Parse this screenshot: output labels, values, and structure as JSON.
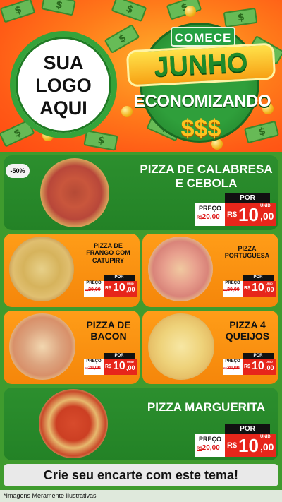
{
  "header": {
    "logo_line1": "SUA",
    "logo_line2": "LOGO",
    "logo_line3": "AQUI",
    "comece": "COMECE",
    "junho": "JUNHO",
    "economizando": "ECONOMIZANDO",
    "dollars": "$$$"
  },
  "discount_badge": "-50%",
  "products": {
    "calabresa": {
      "title_line1": "PIZZA DE CALABRESA",
      "title_line2": "E CEBOLA",
      "por": "POR",
      "preco": "PREÇO",
      "de": "20,00",
      "de_prefix": "R$",
      "currency": "R$",
      "int": "10",
      "dec": ",00",
      "unid": "UNID"
    },
    "frango": {
      "title_line1": "PIZZA DE",
      "title_line2": "FRANGO COM",
      "title_line3": "CATUPIRY",
      "por": "POR",
      "preco": "PREÇO",
      "de": "20,00",
      "de_prefix": "R$",
      "currency": "R$",
      "int": "10",
      "dec": ",00",
      "unid": "UNID"
    },
    "portuguesa": {
      "title_line1": "PIZZA",
      "title_line2": "PORTUGUESA",
      "por": "POR",
      "preco": "PREÇO",
      "de": "20,00",
      "de_prefix": "R$",
      "currency": "R$",
      "int": "10",
      "dec": ",00",
      "unid": "UNID"
    },
    "bacon": {
      "title_line1": "PIZZA DE",
      "title_line2": "BACON",
      "por": "POR",
      "preco": "PREÇO",
      "de": "20,00",
      "de_prefix": "R$",
      "currency": "R$",
      "int": "10",
      "dec": ",00",
      "unid": "UNID"
    },
    "queijos": {
      "title_line1": "PIZZA 4",
      "title_line2": "QUEIJOS",
      "por": "POR",
      "preco": "PREÇO",
      "de": "20,00",
      "de_prefix": "R$",
      "currency": "R$",
      "int": "10",
      "dec": ",00",
      "unid": "UNID"
    },
    "marguerita": {
      "title_line1": "PIZZA MARGUERITA",
      "por": "POR",
      "preco": "PREÇO",
      "de": "20,00",
      "de_prefix": "R$",
      "currency": "R$",
      "int": "10",
      "dec": ",00",
      "unid": "UNID"
    }
  },
  "cta": "Crie seu encarte com este tema!",
  "footnote": "*Imagens Meramente Ilustrativas",
  "colors": {
    "green": "#2c8f2e",
    "orange": "#f5860a",
    "price_red": "#e7261b",
    "background": "#3f9b2e"
  }
}
